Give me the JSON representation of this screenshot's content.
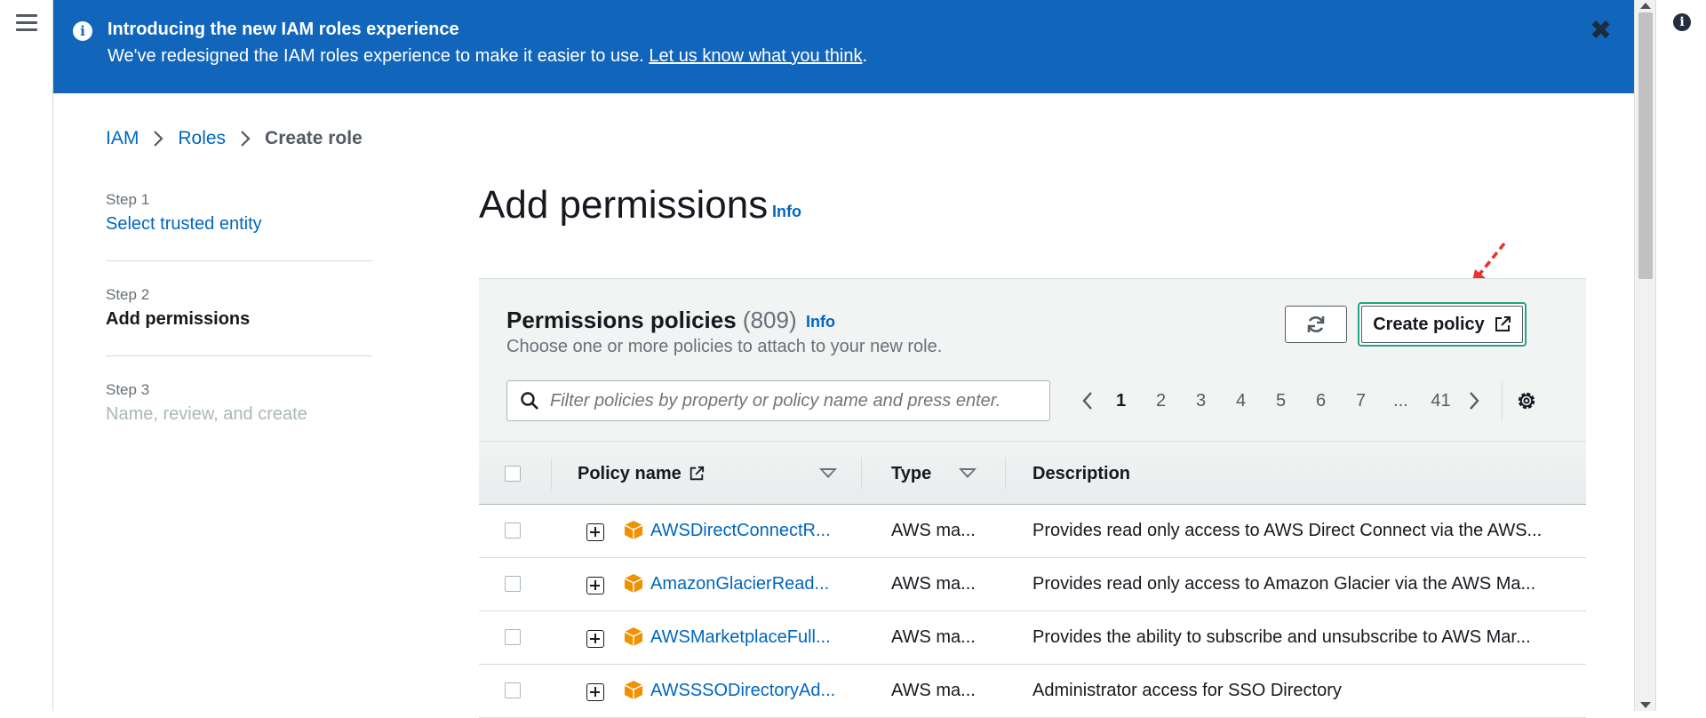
{
  "flash": {
    "title": "Introducing the new IAM roles experience",
    "body": "We've redesigned the IAM roles experience to make it easier to use.",
    "link": "Let us know what you think",
    "link_suffix": ".",
    "close": "✖"
  },
  "breadcrumb": {
    "items": [
      "IAM",
      "Roles"
    ],
    "current": "Create role"
  },
  "steps": [
    {
      "label": "Step 1",
      "name": "Select trusted entity"
    },
    {
      "label": "Step 2",
      "name": "Add permissions"
    },
    {
      "label": "Step 3",
      "name": "Name, review, and create"
    }
  ],
  "page": {
    "title": "Add permissions",
    "info": "Info"
  },
  "policies": {
    "title": "Permissions policies",
    "count": "(809)",
    "info": "Info",
    "description": "Choose one or more policies to attach to your new role.",
    "create_button": "Create policy",
    "filter_placeholder": "Filter policies by property or policy name and press enter."
  },
  "pagination": {
    "pages": [
      "1",
      "2",
      "3",
      "4",
      "5",
      "6",
      "7",
      "...",
      "41"
    ],
    "current": "1"
  },
  "table": {
    "columns": [
      "Policy name",
      "Type",
      "Description"
    ],
    "rows": [
      {
        "name": "AWSDirectConnectR...",
        "type": "AWS ma...",
        "description": "Provides read only access to AWS Direct Connect via the AWS..."
      },
      {
        "name": "AmazonGlacierRead...",
        "type": "AWS ma...",
        "description": "Provides read only access to Amazon Glacier via the AWS Ma..."
      },
      {
        "name": "AWSMarketplaceFull...",
        "type": "AWS ma...",
        "description": "Provides the ability to subscribe and unsubscribe to AWS Mar..."
      },
      {
        "name": "AWSSSODirectoryAd...",
        "type": "AWS ma...",
        "description": "Administrator access for SSO Directory"
      }
    ]
  },
  "colors": {
    "banner": "#1166bb",
    "link": "#0066c0",
    "highlight": "#1fa684",
    "aws_orange": "#f29100",
    "annotation": "#e8322d"
  },
  "icons": [
    "menu-icon",
    "info-circle-icon",
    "close-icon",
    "chevron-right-icon",
    "refresh-icon",
    "external-link-icon",
    "search-icon",
    "chevron-left-icon",
    "gear-icon",
    "sort-caret-icon",
    "expand-plus-icon",
    "aws-cube-icon",
    "arrow-annotation-icon"
  ]
}
